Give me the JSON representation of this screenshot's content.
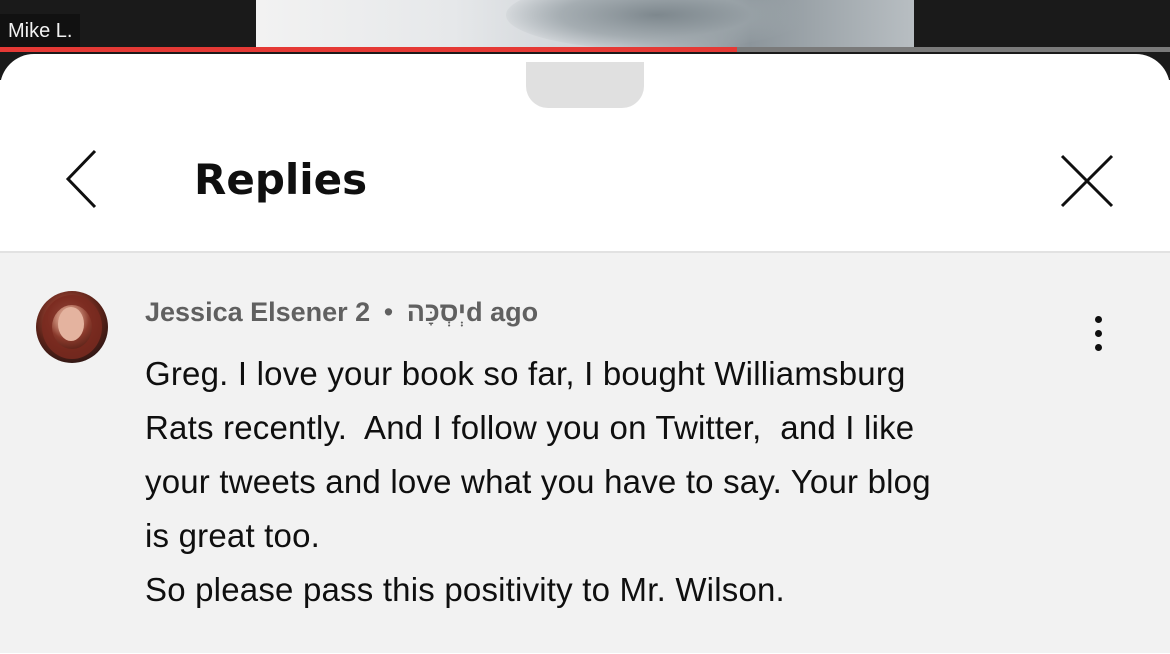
{
  "video": {
    "channel_label": "Mike L.",
    "progress_percent": 63
  },
  "header": {
    "title": "Replies",
    "back_icon": "chevron-left-icon",
    "close_icon": "close-icon"
  },
  "comment": {
    "author": "Jessica Elsener יְסְכָּה",
    "separator": "•",
    "time": "2d ago",
    "menu_icon": "more-vertical-icon",
    "text_lines": [
      "Greg. I love your book so far, I bought Williamsburg",
      "Rats recently.  And I follow you on Twitter,  and I like",
      "your tweets and love what you have to say. Your blog",
      "is great too.",
      "So please pass this positivity to Mr. Wilson."
    ]
  },
  "colors": {
    "progress": "#e53935",
    "comment_background": "#f2f2f2",
    "meta_text": "#606060",
    "body_text": "#0f0f0f"
  }
}
